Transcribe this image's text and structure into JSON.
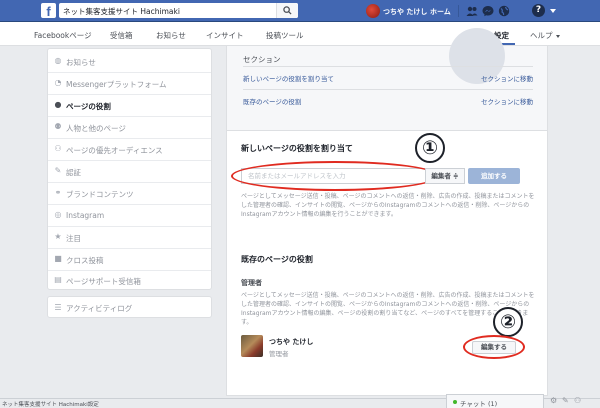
{
  "topbar": {
    "search_value": "ネット集客支援サイト Hachimaki",
    "user_name": "つちや たけし",
    "home_label": "ホーム",
    "help_symbol": "?"
  },
  "subnav": {
    "items": [
      "Facebookページ",
      "受信箱",
      "お知らせ",
      "インサイト",
      "投稿ツール"
    ],
    "settings_label": "設定",
    "help_label": "ヘルプ"
  },
  "sidebar": {
    "items": [
      {
        "label": "お知らせ",
        "icon": "globe-icon"
      },
      {
        "label": "Messengerプラットフォーム",
        "icon": "messenger-icon"
      },
      {
        "label": "ページの役割",
        "icon": "person-icon"
      },
      {
        "label": "人物と他のページ",
        "icon": "people-icon"
      },
      {
        "label": "ページの優先オーディエンス",
        "icon": "audience-icon"
      },
      {
        "label": "認証",
        "icon": "wrench-icon"
      },
      {
        "label": "ブランドコンテンツ",
        "icon": "handshake-icon"
      },
      {
        "label": "Instagram",
        "icon": "instagram-icon"
      },
      {
        "label": "注目",
        "icon": "star-icon"
      },
      {
        "label": "クロス投稿",
        "icon": "video-icon"
      },
      {
        "label": "ページサポート受信箱",
        "icon": "inbox-icon"
      }
    ],
    "activity_log": "アクティビティログ"
  },
  "main": {
    "section_title": "セクション",
    "nav_rows": [
      {
        "label": "新しいページの役割を割り当て",
        "link": "セクションに移動"
      },
      {
        "label": "既存のページの役割",
        "link": "セクションに移動"
      }
    ],
    "assign_title": "新しいページの役割を割り当て",
    "marker1": "①",
    "input_placeholder": "名前またはメールアドレスを入力",
    "role_select": "編集者 ≑",
    "add_button": "追加する",
    "assign_desc": "ページとしてメッセージ送信・投稿、ページのコメントへの返信・削除、広告の作成、投稿またはコメントをした管理者の確認、インサイトの閲覧、ページからのInstagramのコメントへの返信・削除、ページからのInstagramアカウント情報の編集を行うことができます。",
    "existing_title": "既存のページの役割",
    "admin_label": "管理者",
    "admin_desc": "ページとしてメッセージ送信・投稿、ページのコメントへの返信・削除、広告の作成、投稿またはコメントをした管理者の確認、インサイトの閲覧、ページからのInstagramのコメントへの返信・削除、ページからのInstagramアカウント情報の編集、ページの役割の割り当てなど、ページのすべてを管理することができます。",
    "marker2": "②",
    "person": {
      "name": "つちや たけし",
      "role": "管理者"
    },
    "edit_button": "編集する"
  },
  "statusbar": {
    "text": "ネット集客支援サイト Hachimaki設定"
  },
  "chat": {
    "label": "チャット (1)"
  },
  "colors": {
    "brand": "#4267b2",
    "highlight": "#e02b20",
    "online": "#42b72a"
  }
}
